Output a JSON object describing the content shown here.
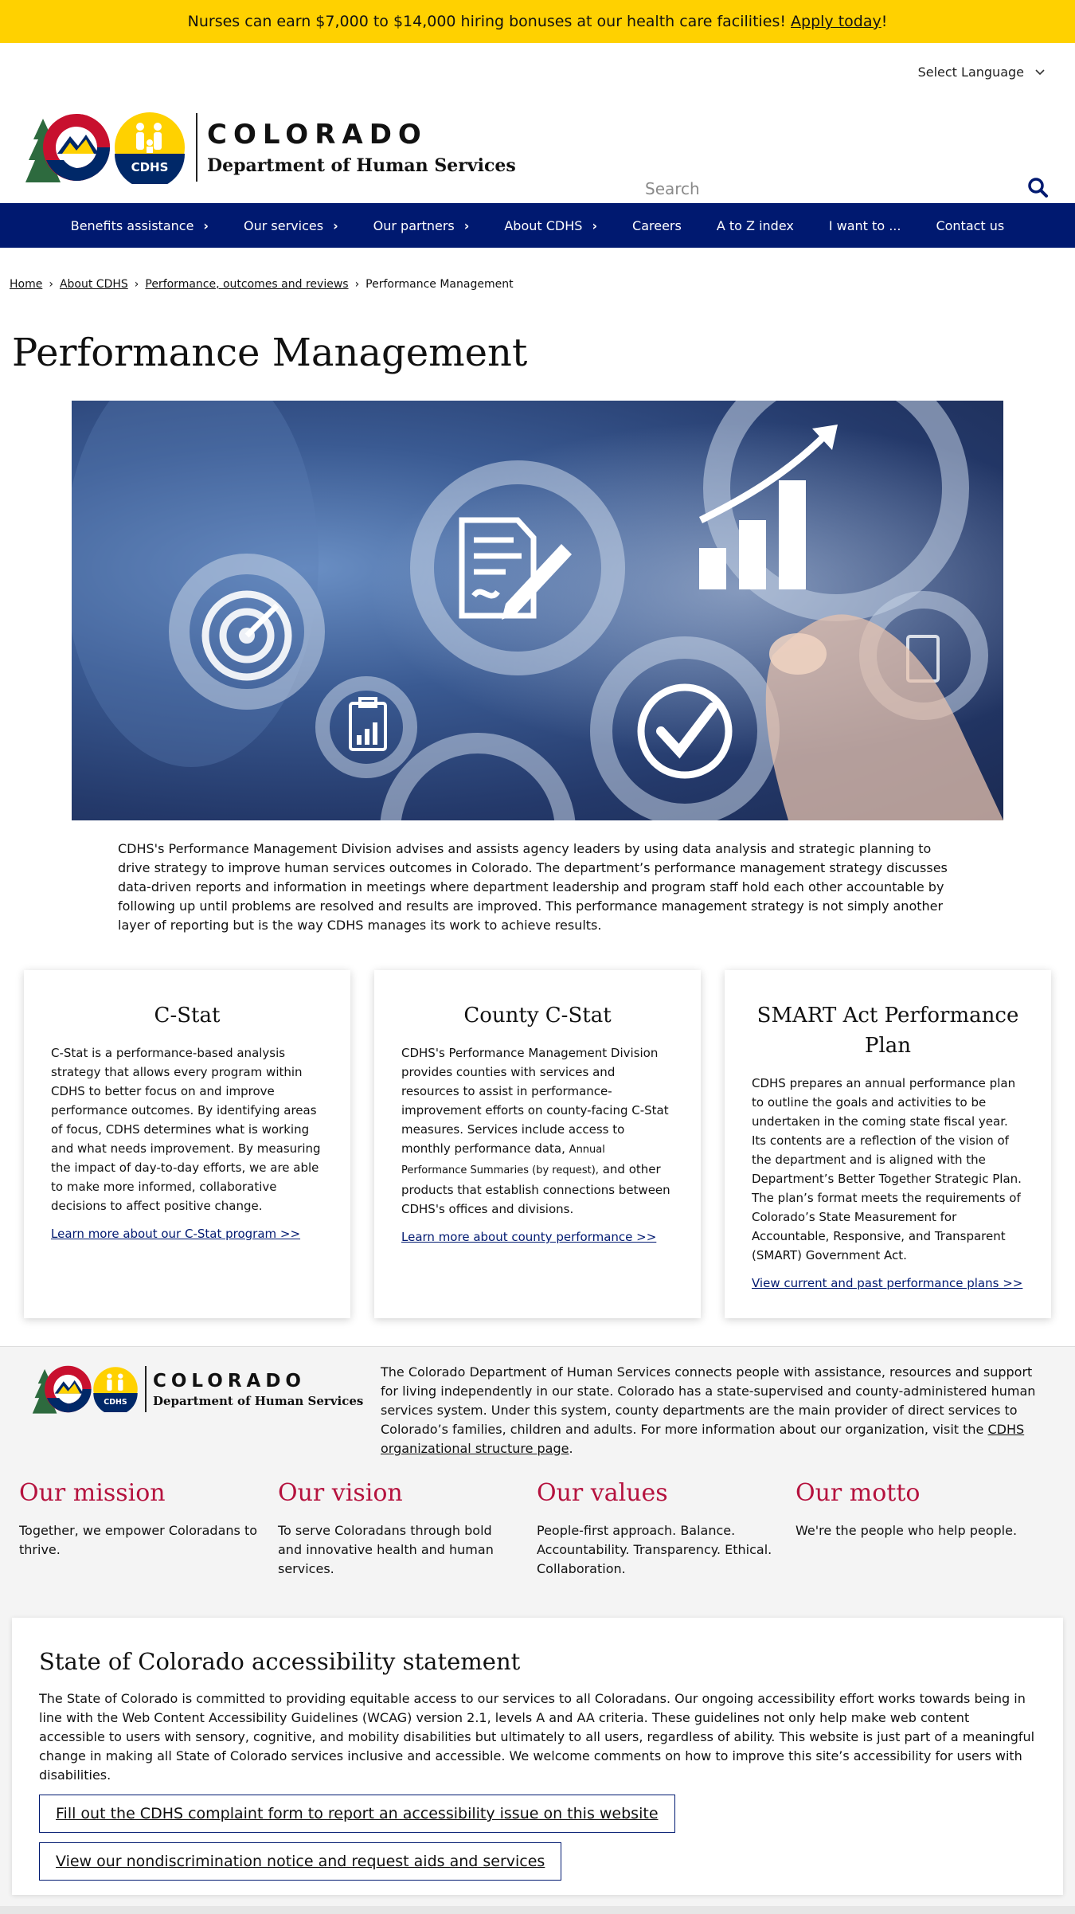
{
  "alert": {
    "text": "Nurses can earn $7,000 to $14,000 hiring bonuses at our health care facilities!",
    "link": "Apply today",
    "suffix": "!"
  },
  "header": {
    "language_label": "Select Language",
    "logo_co": "COLORADO",
    "logo_dept": "Department of Human Services",
    "logo_badge": "CDHS",
    "search_placeholder": "Search"
  },
  "nav": {
    "items": [
      {
        "label": "Benefits assistance",
        "has_arrow": true
      },
      {
        "label": "Our services",
        "has_arrow": true
      },
      {
        "label": "Our partners",
        "has_arrow": true
      },
      {
        "label": "About CDHS",
        "has_arrow": true
      },
      {
        "label": "Careers",
        "has_arrow": false
      },
      {
        "label": "A to Z index",
        "has_arrow": false
      },
      {
        "label": "I want to ...",
        "has_arrow": false
      },
      {
        "label": "Contact us",
        "has_arrow": false
      }
    ]
  },
  "breadcrumb": {
    "items": [
      "Home",
      "About CDHS",
      "Performance, outcomes and reviews"
    ],
    "current": "Performance Management"
  },
  "page_title": "Performance Management",
  "intro": "CDHS's Performance Management Division advises and assists agency leaders by using data analysis and strategic planning to drive strategy to improve human services outcomes in Colorado. The department’s performance management strategy discusses data-driven reports and information in meetings where department leadership and program staff hold each other accountable by following up until problems are resolved and results are improved. This performance management strategy is not simply another layer of reporting but is the way CDHS manages its work to achieve results.",
  "cards": [
    {
      "title": "C-Stat",
      "body": "C-Stat is a performance-based analysis strategy that allows every program within CDHS to better focus on and improve performance outcomes. By identifying areas of focus, CDHS determines what is working and what needs improvement. By measuring the impact of day-to-day efforts, we are able to make more informed, collaborative decisions to affect positive change.",
      "link": "Learn more about our C-Stat program >>"
    },
    {
      "title": "County C-Stat",
      "body_a": "CDHS's Performance Management Division provides counties with services and resources to assist in performance-improvement efforts on county-facing C-Stat measures. Services include access to monthly performance data,",
      "body_small": "Annual Performance Summaries (by request),",
      "body_b": "and other products that establish connections between CDHS's offices and divisions.",
      "link": "Learn more about county performance >>"
    },
    {
      "title": "SMART Act Performance Plan",
      "body": "CDHS prepares an annual performance plan to outline the goals and activities to be undertaken in the coming state fiscal year. Its contents are a reflection of the vision of the department and is aligned with the Department’s Better Together Strategic Plan. The plan’s format meets the requirements of Colorado’s State Measurement for Accountable, Responsive, and Transparent (SMART) Government Act.",
      "link": "View current and past performance plans >>"
    }
  ],
  "footer": {
    "description": "The Colorado Department of Human Services connects people with assistance, resources and support for living independently in our state. Colorado has a state-supervised and county-administered human services system. Under this system, county departments are the main provider of direct services to Colorado’s families, children and adults. For more information about our organization, visit the",
    "description_link": "CDHS organizational structure page",
    "description_end": ".",
    "values": [
      {
        "title": "Our mission",
        "text": "Together, we empower Coloradans to thrive."
      },
      {
        "title": "Our vision",
        "text": "To serve Coloradans through bold and innovative health and human services."
      },
      {
        "title": "Our values",
        "text": "People-first approach. Balance. Accountability. Transparency. Ethical. Collaboration."
      },
      {
        "title": "Our motto",
        "text": "We're the people who help people."
      }
    ],
    "accessibility": {
      "title": "State of Colorado accessibility statement",
      "text": "The State of Colorado is committed to providing equitable access to our services to all Coloradans. Our ongoing accessibility effort works towards being in line with the Web Content Accessibility Guidelines (WCAG) version 2.1, levels A and AA criteria. These guidelines not only help make web content accessible to users with sensory, cognitive, and mobility disabilities but ultimately to all users, regardless of ability. This website is just part of a meaningful change in making all State of Colorado services inclusive and accessible. We welcome comments on how to improve this site’s accessibility for users with disabilities.",
      "button1": "Fill out the CDHS complaint form to report an accessibility issue on this website",
      "button2": "View our nondiscrimination notice and request aids and services"
    }
  },
  "colors": {
    "alert_bg": "#FFD100",
    "nav_bg": "#001970",
    "accent_red": "#B5123E",
    "logo_red": "#C8102E",
    "logo_blue": "#002868",
    "logo_gold": "#FFD100",
    "logo_green": "#2D6A3E"
  }
}
